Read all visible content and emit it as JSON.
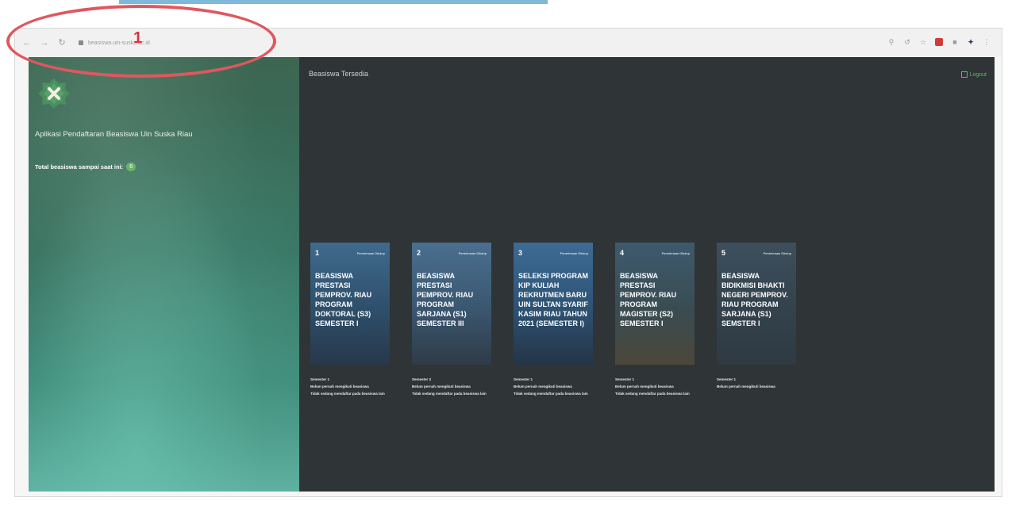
{
  "annotation": {
    "number": "1"
  },
  "browser": {
    "url": "beasiswa.uin-suska.ac.id"
  },
  "sidebar": {
    "app_title": "Aplikasi Pendaftaran Beasiswa Uin Suska Riau",
    "total_label": "Total beasiswa sampai saat ini:",
    "total_count": "6"
  },
  "main": {
    "section_title": "Beasiswa Tersedia",
    "logout_label": "Logout"
  },
  "cards": [
    {
      "number": "1",
      "status": "Penerimaan Ditutup",
      "title": "BEASISWA PRESTASI PEMPROV. RIAU PROGRAM DOKTORAL (S3) SEMESTER I",
      "info": [
        "Semester 1",
        "Belum pernah mengikuti beasiswa",
        "Tidak sedang mendaftar pada beasiswa lain"
      ]
    },
    {
      "number": "2",
      "status": "Penerimaan Ditutup",
      "title": "BEASISWA PRESTASI PEMPROV. RIAU PROGRAM SARJANA (S1) SEMESTER III",
      "info": [
        "Semester 3",
        "Belum pernah mengikuti beasiswa",
        "Tidak sedang mendaftar pada beasiswa lain"
      ]
    },
    {
      "number": "3",
      "status": "Penerimaan Ditutup",
      "title": "SELEKSI PROGRAM KIP KULIAH REKRUTMEN BARU UIN SULTAN SYARIF KASIM RIAU TAHUN 2021 (SEMESTER I)",
      "info": [
        "Semester 1",
        "Belum pernah mengikuti beasiswa",
        "Tidak sedang mendaftar pada beasiswa lain"
      ]
    },
    {
      "number": "4",
      "status": "Penerimaan Ditutup",
      "title": "BEASISWA PRESTASI PEMPROV. RIAU PROGRAM MAGISTER (S2) SEMESTER I",
      "info": [
        "Semester 1",
        "Belum pernah mengikuti beasiswa",
        "Tidak sedang mendaftar pada beasiswa lain"
      ]
    },
    {
      "number": "5",
      "status": "Penerimaan Ditutup",
      "title": "BEASISWA BIDIKMISI BHAKTI NEGERI PEMPROV. RIAU PROGRAM SARJANA (S1) SEMSTER I",
      "info": [
        "Semester 1",
        "Belum pernah mengikuti beasiswa"
      ]
    }
  ],
  "colors": {
    "sidebar_green": "#35705e",
    "main_bg": "#2f3436",
    "accent_green": "#4fbf5a",
    "annotation_red": "#e0575f"
  }
}
